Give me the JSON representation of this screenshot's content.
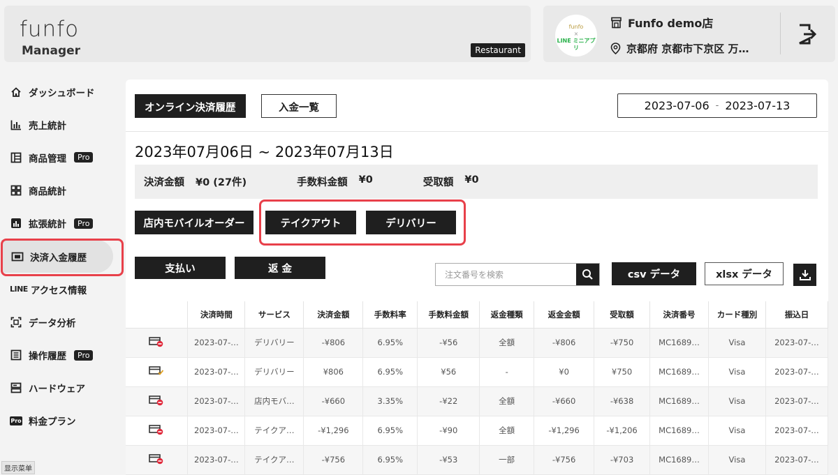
{
  "header": {
    "logo_text": "funfo",
    "logo_sub": "Manager",
    "business_type": "Restaurant",
    "store_avatar_line1": "funfo",
    "store_avatar_line2": "×",
    "store_avatar_line3": "LINE ミニアプリ",
    "store_name": "Funfo demo店",
    "store_address": "京都府 京都市下京区 万…"
  },
  "sidebar": {
    "items": [
      {
        "label": "ダッシュボード",
        "icon": "home-icon",
        "pro": false,
        "active": false
      },
      {
        "label": "売上統計",
        "icon": "bar-chart-icon",
        "pro": false,
        "active": false
      },
      {
        "label": "商品管理",
        "icon": "layout-icon",
        "pro": true,
        "active": false
      },
      {
        "label": "商品統計",
        "icon": "grid-icon",
        "pro": false,
        "active": false
      },
      {
        "label": "拡張統計",
        "icon": "stats-icon",
        "pro": true,
        "active": false
      },
      {
        "label": "決済入金履歴",
        "icon": "payment-icon",
        "pro": false,
        "active": true
      },
      {
        "label": "アクセス情報",
        "icon": "line-icon",
        "pro": false,
        "active": false
      },
      {
        "label": "データ分析",
        "icon": "scan-icon",
        "pro": false,
        "active": false
      },
      {
        "label": "操作履歴",
        "icon": "list-icon",
        "pro": true,
        "active": false
      },
      {
        "label": "ハードウェア",
        "icon": "hardware-icon",
        "pro": false,
        "active": false
      },
      {
        "label": "料金プラン",
        "icon": "pro-icon",
        "pro": false,
        "active": false
      }
    ],
    "line_prefix": "LINE",
    "pro_label": "Pro",
    "pro_icon_text": "Pro",
    "footer_label": "显示菜单"
  },
  "main": {
    "tabs": [
      "オンライン決済履歴",
      "入金一覧"
    ],
    "date_start": "2023-07-06",
    "date_sep": "-",
    "date_end": "2023-07-13",
    "period_title": "2023年07月06日 ~ 2023年07月13日",
    "summary": {
      "amount_label": "決済金額",
      "amount_value": "¥0 (27件)",
      "fee_label": "手数料金額",
      "fee_value": "¥0",
      "received_label": "受取額",
      "received_value": "¥0"
    },
    "services": [
      "店内モバイルオーダー",
      "テイクアウト",
      "デリバリー"
    ],
    "pay_button": "支払い",
    "refund_button": "返 金",
    "search_placeholder": "注文番号を検索",
    "csv_button": "csv データ",
    "xlsx_button": "xlsx データ"
  },
  "table": {
    "headers": [
      "",
      "決済時間",
      "サービス",
      "決済金額",
      "手数料率",
      "手数料金額",
      "返金種類",
      "返金金額",
      "受取額",
      "決済番号",
      "カード種別",
      "振込日"
    ],
    "rows": [
      {
        "status": "refund",
        "cells": [
          "2023-07-…",
          "デリバリー",
          "-¥806",
          "6.95%",
          "-¥56",
          "全額",
          "-¥806",
          "-¥750",
          "MC1689…",
          "Visa",
          "2023-07-…"
        ]
      },
      {
        "status": "paid",
        "cells": [
          "2023-07-…",
          "デリバリー",
          "¥806",
          "6.95%",
          "¥56",
          "-",
          "¥0",
          "¥750",
          "MC1689…",
          "Visa",
          "2023-07-…"
        ]
      },
      {
        "status": "refund",
        "cells": [
          "2023-07-…",
          "店内モバ…",
          "-¥660",
          "3.35%",
          "-¥22",
          "全額",
          "-¥660",
          "-¥638",
          "MC1689…",
          "Visa",
          "2023-07-…"
        ]
      },
      {
        "status": "refund",
        "cells": [
          "2023-07-…",
          "テイクア…",
          "-¥1,296",
          "6.95%",
          "-¥90",
          "全額",
          "-¥1,296",
          "-¥1,206",
          "MC1689…",
          "Visa",
          "2023-07-…"
        ]
      },
      {
        "status": "refund",
        "cells": [
          "2023-07-…",
          "テイクア…",
          "-¥756",
          "6.95%",
          "-¥53",
          "一部",
          "-¥756",
          "-¥703",
          "MC1689…",
          "Visa",
          "2023-07-…"
        ]
      }
    ]
  },
  "colors": {
    "highlight": "#e8404a",
    "dark": "#1f1f1f",
    "line_green": "#2bb24c"
  }
}
